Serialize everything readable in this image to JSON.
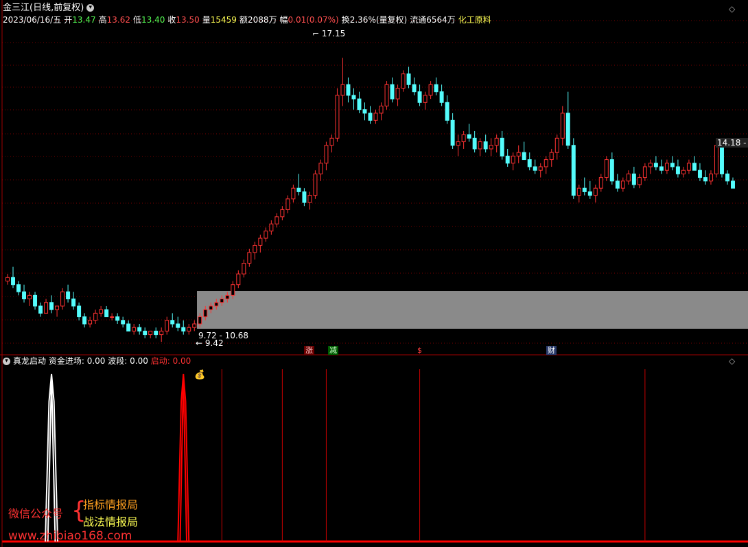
{
  "header": {
    "title": "金三江(日线,前复权)"
  },
  "info_bar": {
    "date": "2023/06/16/五",
    "open_label": "开",
    "open": "13.47",
    "high_label": "高",
    "high": "13.62",
    "low_label": "低",
    "low": "13.40",
    "close_label": "收",
    "close": "13.50",
    "volume_label": "量",
    "volume": "15459",
    "amount_label": "额",
    "amount": "2088万",
    "change_label": "幅",
    "change": "0.01(0.07%)",
    "turnover_label": "换",
    "turnover": "2.36%(量复权)",
    "float_label": "流通",
    "float": "6564万",
    "sector": "化工原料"
  },
  "price_annotations": {
    "high_mark": "17.15",
    "low_mark": "9.42",
    "range_label": "9.72 - 10.68",
    "right_price": "14.18 -"
  },
  "event_tags": [
    "涨",
    "减",
    "$",
    "财"
  ],
  "indicator": {
    "name": "真龙启动",
    "fund_label": "资金进场:",
    "fund_value": "0.00",
    "wave_label": "波段:",
    "wave_value": "0.00",
    "start_label": "启动:",
    "start_value": "0.00"
  },
  "watermark": {
    "wechat": "微信公众号",
    "brace": "{",
    "line1": "指标情报局",
    "line2": "战法情报局",
    "url": "www.zhibiao168.com"
  },
  "colors": {
    "up": "#ff3232",
    "down": "#54fcfc",
    "signal": "#ff0000",
    "white_signal": "#ffffff",
    "box": "#8a8a8a",
    "grid": "#7a0000"
  },
  "chart_data": {
    "type": "candlestick",
    "ylim": [
      9.2,
      18.0
    ],
    "grid": "dotted",
    "candles": [
      [
        10.9,
        11.1,
        10.8,
        11.0
      ],
      [
        11.0,
        11.3,
        10.7,
        10.8
      ],
      [
        10.8,
        10.9,
        10.5,
        10.6
      ],
      [
        10.6,
        10.8,
        10.3,
        10.4
      ],
      [
        10.4,
        10.6,
        10.2,
        10.5
      ],
      [
        10.5,
        10.6,
        10.1,
        10.2
      ],
      [
        10.2,
        10.3,
        9.9,
        10.0
      ],
      [
        10.0,
        10.4,
        10.0,
        10.3
      ],
      [
        10.3,
        10.5,
        10.0,
        10.1
      ],
      [
        10.1,
        10.2,
        9.9,
        10.2
      ],
      [
        10.2,
        10.7,
        10.1,
        10.6
      ],
      [
        10.6,
        10.8,
        10.3,
        10.4
      ],
      [
        10.4,
        10.6,
        10.1,
        10.2
      ],
      [
        10.2,
        10.3,
        9.8,
        9.9
      ],
      [
        9.9,
        10.0,
        9.6,
        9.7
      ],
      [
        9.7,
        9.9,
        9.6,
        9.8
      ],
      [
        9.8,
        10.1,
        9.7,
        10.0
      ],
      [
        10.0,
        10.2,
        9.9,
        10.1
      ],
      [
        10.1,
        10.2,
        9.9,
        9.9
      ],
      [
        9.9,
        10.0,
        9.8,
        9.9
      ],
      [
        9.9,
        10.0,
        9.7,
        9.8
      ],
      [
        9.8,
        9.9,
        9.6,
        9.7
      ],
      [
        9.7,
        9.8,
        9.5,
        9.5
      ],
      [
        9.5,
        9.7,
        9.4,
        9.6
      ],
      [
        9.6,
        9.7,
        9.4,
        9.5
      ],
      [
        9.5,
        9.6,
        9.3,
        9.4
      ],
      [
        9.4,
        9.5,
        9.3,
        9.5
      ],
      [
        9.5,
        9.6,
        9.3,
        9.4
      ],
      [
        9.4,
        9.6,
        9.2,
        9.5
      ],
      [
        9.5,
        9.9,
        9.4,
        9.8
      ],
      [
        9.8,
        10.0,
        9.6,
        9.7
      ],
      [
        9.7,
        9.9,
        9.5,
        9.6
      ],
      [
        9.6,
        9.8,
        9.4,
        9.5
      ],
      [
        9.5,
        9.7,
        9.4,
        9.6
      ],
      [
        9.6,
        9.8,
        9.5,
        9.7
      ],
      [
        9.7,
        10.0,
        9.6,
        9.9
      ],
      [
        9.9,
        10.2,
        9.8,
        10.1
      ],
      [
        10.1,
        10.3,
        10.0,
        10.2
      ],
      [
        10.2,
        10.4,
        10.1,
        10.3
      ],
      [
        10.3,
        10.5,
        10.2,
        10.4
      ],
      [
        10.4,
        10.6,
        10.3,
        10.5
      ],
      [
        10.5,
        10.9,
        10.4,
        10.8
      ],
      [
        10.8,
        11.2,
        10.7,
        11.1
      ],
      [
        11.1,
        11.5,
        11.0,
        11.4
      ],
      [
        11.4,
        11.8,
        11.3,
        11.7
      ],
      [
        11.7,
        12.0,
        11.5,
        11.9
      ],
      [
        11.9,
        12.2,
        11.7,
        12.1
      ],
      [
        12.1,
        12.4,
        12.0,
        12.3
      ],
      [
        12.3,
        12.6,
        12.2,
        12.5
      ],
      [
        12.5,
        12.8,
        12.4,
        12.7
      ],
      [
        12.7,
        13.0,
        12.6,
        12.9
      ],
      [
        12.9,
        13.3,
        12.8,
        13.2
      ],
      [
        13.2,
        13.6,
        13.1,
        13.5
      ],
      [
        13.5,
        13.9,
        13.3,
        13.4
      ],
      [
        13.4,
        13.5,
        13.0,
        13.1
      ],
      [
        13.1,
        13.4,
        12.9,
        13.3
      ],
      [
        13.3,
        14.0,
        13.2,
        13.9
      ],
      [
        13.9,
        14.3,
        13.7,
        14.2
      ],
      [
        14.2,
        14.8,
        14.0,
        14.7
      ],
      [
        14.7,
        15.0,
        14.5,
        14.9
      ],
      [
        14.9,
        16.3,
        14.8,
        16.1
      ],
      [
        16.1,
        17.15,
        15.8,
        16.4
      ],
      [
        16.4,
        16.6,
        15.9,
        16.1
      ],
      [
        16.1,
        16.3,
        15.7,
        16.0
      ],
      [
        16.0,
        16.2,
        15.6,
        15.7
      ],
      [
        15.7,
        15.9,
        15.4,
        15.6
      ],
      [
        15.6,
        15.8,
        15.3,
        15.4
      ],
      [
        15.4,
        15.7,
        15.3,
        15.6
      ],
      [
        15.6,
        15.9,
        15.4,
        15.8
      ],
      [
        15.8,
        16.5,
        15.7,
        16.4
      ],
      [
        16.4,
        16.6,
        15.9,
        16.0
      ],
      [
        16.0,
        16.4,
        15.8,
        16.3
      ],
      [
        16.3,
        16.8,
        16.2,
        16.7
      ],
      [
        16.7,
        16.9,
        16.3,
        16.4
      ],
      [
        16.4,
        16.6,
        16.1,
        16.2
      ],
      [
        16.2,
        16.4,
        15.8,
        15.9
      ],
      [
        15.9,
        16.2,
        15.7,
        16.1
      ],
      [
        16.1,
        16.5,
        16.0,
        16.4
      ],
      [
        16.4,
        16.6,
        16.1,
        16.2
      ],
      [
        16.2,
        16.4,
        15.8,
        15.9
      ],
      [
        15.9,
        16.1,
        15.3,
        15.4
      ],
      [
        15.4,
        15.6,
        14.6,
        14.7
      ],
      [
        14.7,
        15.0,
        14.4,
        14.8
      ],
      [
        14.8,
        15.1,
        14.6,
        15.0
      ],
      [
        15.0,
        15.3,
        14.8,
        14.9
      ],
      [
        14.9,
        15.1,
        14.5,
        14.6
      ],
      [
        14.6,
        14.9,
        14.4,
        14.8
      ],
      [
        14.8,
        15.0,
        14.5,
        14.6
      ],
      [
        14.6,
        14.9,
        14.4,
        14.7
      ],
      [
        14.7,
        15.0,
        14.5,
        14.9
      ],
      [
        14.9,
        15.1,
        14.3,
        14.4
      ],
      [
        14.4,
        14.6,
        14.1,
        14.2
      ],
      [
        14.2,
        14.5,
        14.0,
        14.4
      ],
      [
        14.4,
        14.7,
        14.2,
        14.5
      ],
      [
        14.5,
        14.8,
        14.3,
        14.3
      ],
      [
        14.3,
        14.5,
        14.0,
        14.1
      ],
      [
        14.1,
        14.3,
        13.9,
        14.0
      ],
      [
        14.0,
        14.2,
        13.8,
        14.1
      ],
      [
        14.1,
        14.4,
        13.9,
        14.3
      ],
      [
        14.3,
        14.6,
        14.1,
        14.5
      ],
      [
        14.5,
        15.0,
        14.3,
        14.9
      ],
      [
        14.9,
        15.8,
        14.7,
        15.6
      ],
      [
        15.6,
        16.2,
        14.6,
        14.7
      ],
      [
        14.7,
        14.9,
        13.2,
        13.3
      ],
      [
        13.3,
        13.6,
        13.1,
        13.5
      ],
      [
        13.5,
        13.8,
        13.3,
        13.4
      ],
      [
        13.4,
        13.7,
        13.2,
        13.3
      ],
      [
        13.3,
        13.6,
        13.1,
        13.5
      ],
      [
        13.5,
        13.9,
        13.4,
        13.8
      ],
      [
        13.8,
        14.4,
        13.7,
        14.3
      ],
      [
        14.3,
        14.5,
        13.6,
        13.7
      ],
      [
        13.7,
        13.9,
        13.4,
        13.5
      ],
      [
        13.5,
        13.8,
        13.4,
        13.7
      ],
      [
        13.7,
        14.0,
        13.6,
        13.9
      ],
      [
        13.9,
        14.1,
        13.5,
        13.6
      ],
      [
        13.6,
        13.9,
        13.5,
        13.8
      ],
      [
        13.8,
        14.2,
        13.7,
        14.1
      ],
      [
        14.1,
        14.3,
        13.9,
        14.2
      ],
      [
        14.2,
        14.4,
        14.0,
        14.1
      ],
      [
        14.1,
        14.3,
        13.9,
        14.0
      ],
      [
        14.0,
        14.3,
        13.9,
        14.2
      ],
      [
        14.2,
        14.4,
        14.0,
        14.1
      ],
      [
        14.1,
        14.3,
        13.8,
        13.9
      ],
      [
        13.9,
        14.1,
        13.8,
        14.0
      ],
      [
        14.0,
        14.3,
        13.9,
        14.2
      ],
      [
        14.2,
        14.4,
        14.0,
        14.0
      ],
      [
        14.0,
        14.2,
        13.7,
        13.8
      ],
      [
        13.8,
        14.0,
        13.6,
        13.7
      ],
      [
        13.7,
        14.0,
        13.6,
        13.9
      ],
      [
        13.9,
        14.8,
        13.8,
        14.7
      ],
      [
        14.7,
        14.9,
        13.8,
        13.9
      ],
      [
        13.9,
        14.0,
        13.6,
        13.7
      ],
      [
        13.7,
        13.8,
        13.5,
        13.5
      ]
    ],
    "indicator_white_peak_index": 8,
    "indicator_red_peak_index": 32,
    "indicator_vlines_index": [
      39,
      50,
      58,
      75,
      116
    ]
  }
}
